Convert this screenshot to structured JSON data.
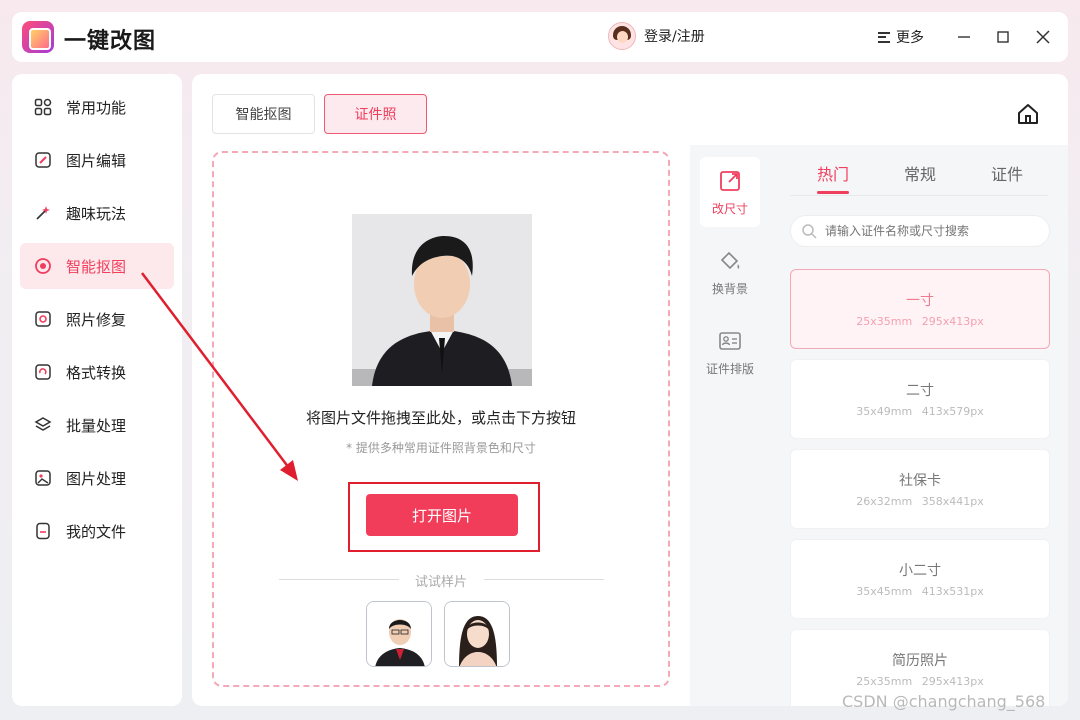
{
  "app": {
    "title": "一键改图"
  },
  "header": {
    "login_label": "登录/注册",
    "more_label": "更多"
  },
  "sidebar": {
    "items": [
      {
        "label": "常用功能",
        "icon": "grid-icon"
      },
      {
        "label": "图片编辑",
        "icon": "edit-icon"
      },
      {
        "label": "趣味玩法",
        "icon": "magic-icon"
      },
      {
        "label": "智能抠图",
        "icon": "cutout-icon",
        "active": true
      },
      {
        "label": "照片修复",
        "icon": "repair-icon"
      },
      {
        "label": "格式转换",
        "icon": "convert-icon"
      },
      {
        "label": "批量处理",
        "icon": "layers-icon"
      },
      {
        "label": "图片处理",
        "icon": "image-icon"
      },
      {
        "label": "我的文件",
        "icon": "file-icon"
      }
    ]
  },
  "main": {
    "tabs": [
      {
        "label": "智能抠图"
      },
      {
        "label": "证件照",
        "active": true
      }
    ],
    "dropzone": {
      "hint": "将图片文件拖拽至此处，或点击下方按钮",
      "sub_hint": "* 提供多种常用证件照背景色和尺寸",
      "open_button": "打开图片",
      "samples_label": "试试样片"
    },
    "functions": [
      {
        "label": "改尺寸",
        "active": true
      },
      {
        "label": "换背景"
      },
      {
        "label": "证件排版"
      }
    ],
    "right_tabs": [
      {
        "label": "热门",
        "active": true
      },
      {
        "label": "常规"
      },
      {
        "label": "证件"
      }
    ],
    "search_placeholder": "请输入证件名称或尺寸搜索",
    "sizes": [
      {
        "name": "一寸",
        "mm": "25x35mm",
        "px": "295x413px",
        "selected": true
      },
      {
        "name": "二寸",
        "mm": "35x49mm",
        "px": "413x579px"
      },
      {
        "name": "社保卡",
        "mm": "26x32mm",
        "px": "358x441px"
      },
      {
        "name": "小二寸",
        "mm": "35x45mm",
        "px": "413x531px"
      },
      {
        "name": "简历照片",
        "mm": "25x35mm",
        "px": "295x413px"
      }
    ]
  },
  "watermark": "CSDN @changchang_568",
  "colors": {
    "accent": "#f03e5d",
    "accent_light": "#fde8ec",
    "annotation_red": "#e01f2e"
  }
}
